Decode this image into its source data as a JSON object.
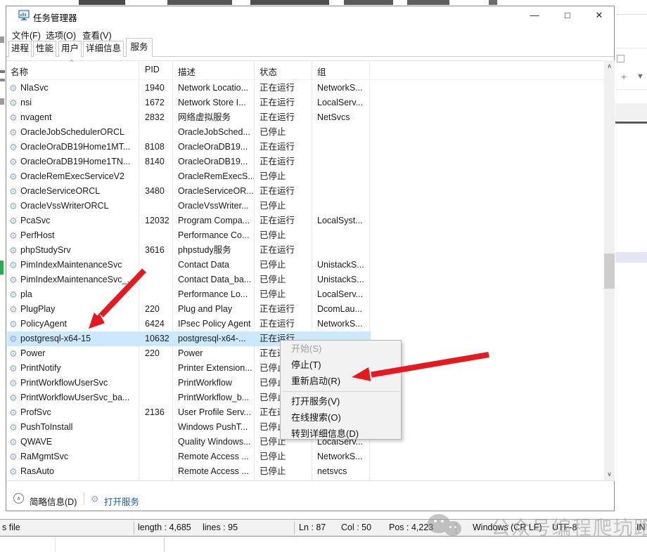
{
  "window": {
    "title": "任务管理器",
    "menu": [
      {
        "label": "文件(F)"
      },
      {
        "label": "选项(O)"
      },
      {
        "label": "查看(V)"
      }
    ],
    "tabs": [
      {
        "label": "进程"
      },
      {
        "label": "性能"
      },
      {
        "label": "用户"
      },
      {
        "label": "详细信息"
      },
      {
        "label": "服务"
      }
    ],
    "caption_buttons": {
      "minimize": "—",
      "maximize": "□",
      "close": "✕"
    }
  },
  "table": {
    "columns": [
      "名称",
      "PID",
      "描述",
      "状态",
      "组"
    ],
    "rows": [
      {
        "name": "NlaSvc",
        "pid": "1940",
        "desc": "Network Locatio...",
        "status": "正在运行",
        "group": "NetworkS..."
      },
      {
        "name": "nsi",
        "pid": "1672",
        "desc": "Network Store I...",
        "status": "正在运行",
        "group": "LocalServ..."
      },
      {
        "name": "nvagent",
        "pid": "2832",
        "desc": "网络虚拟服务",
        "status": "正在运行",
        "group": "NetSvcs"
      },
      {
        "name": "OracleJobSchedulerORCL",
        "pid": "",
        "desc": "OracleJobSched...",
        "status": "已停止",
        "group": ""
      },
      {
        "name": "OracleOraDB19Home1MT...",
        "pid": "8108",
        "desc": "OracleOraDB19...",
        "status": "正在运行",
        "group": ""
      },
      {
        "name": "OracleOraDB19Home1TN...",
        "pid": "8140",
        "desc": "OracleOraDB19...",
        "status": "正在运行",
        "group": ""
      },
      {
        "name": "OracleRemExecServiceV2",
        "pid": "",
        "desc": "OracleRemExecS...",
        "status": "已停止",
        "group": ""
      },
      {
        "name": "OracleServiceORCL",
        "pid": "3480",
        "desc": "OracleServiceOR...",
        "status": "正在运行",
        "group": ""
      },
      {
        "name": "OracleVssWriterORCL",
        "pid": "",
        "desc": "OracleVssWriter...",
        "status": "已停止",
        "group": ""
      },
      {
        "name": "PcaSvc",
        "pid": "12032",
        "desc": "Program Compa...",
        "status": "正在运行",
        "group": "LocalSyst..."
      },
      {
        "name": "PerfHost",
        "pid": "",
        "desc": "Performance Co...",
        "status": "已停止",
        "group": ""
      },
      {
        "name": "phpStudySrv",
        "pid": "3616",
        "desc": "phpstudy服务",
        "status": "正在运行",
        "group": ""
      },
      {
        "name": "PimIndexMaintenanceSvc",
        "pid": "",
        "desc": "Contact Data",
        "status": "已停止",
        "group": "UnistackS..."
      },
      {
        "name": "PimIndexMaintenanceSvc_...",
        "pid": "",
        "desc": "Contact Data_ba...",
        "status": "已停止",
        "group": "UnistackS..."
      },
      {
        "name": "pla",
        "pid": "",
        "desc": "Performance Lo...",
        "status": "已停止",
        "group": "LocalServ..."
      },
      {
        "name": "PlugPlay",
        "pid": "220",
        "desc": "Plug and Play",
        "status": "正在运行",
        "group": "DcomLau..."
      },
      {
        "name": "PolicyAgent",
        "pid": "6424",
        "desc": "IPsec Policy Agent",
        "status": "正在运行",
        "group": "NetworkS..."
      },
      {
        "name": "postgresql-x64-15",
        "pid": "10632",
        "desc": "postgresql-x64-...",
        "status": "正在运行",
        "group": "",
        "selected": true
      },
      {
        "name": "Power",
        "pid": "220",
        "desc": "Power",
        "status": "正在运行",
        "group": ""
      },
      {
        "name": "PrintNotify",
        "pid": "",
        "desc": "Printer Extension...",
        "status": "已停止",
        "group": ""
      },
      {
        "name": "PrintWorkflowUserSvc",
        "pid": "",
        "desc": "PrintWorkflow",
        "status": "已停止",
        "group": ""
      },
      {
        "name": "PrintWorkflowUserSvc_ba...",
        "pid": "",
        "desc": "PrintWorkflow_b...",
        "status": "已停止",
        "group": ""
      },
      {
        "name": "ProfSvc",
        "pid": "2136",
        "desc": "User Profile Serv...",
        "status": "正在运行",
        "group": ""
      },
      {
        "name": "PushToInstall",
        "pid": "",
        "desc": "Windows PushT...",
        "status": "已停止",
        "group": ""
      },
      {
        "name": "QWAVE",
        "pid": "",
        "desc": "Quality Windows...",
        "status": "已停止",
        "group": "LocalServ..."
      },
      {
        "name": "RaMgmtSvc",
        "pid": "",
        "desc": "Remote Access ...",
        "status": "已停止",
        "group": "NetworkS..."
      },
      {
        "name": "RasAuto",
        "pid": "",
        "desc": "Remote Access ...",
        "status": "已停止",
        "group": "netsvcs"
      }
    ]
  },
  "context_menu": {
    "items": [
      {
        "label": "开始(S)",
        "disabled": true
      },
      {
        "label": "停止(T)"
      },
      {
        "label": "重新启动(R)"
      },
      {
        "separator": true
      },
      {
        "label": "打开服务(V)"
      },
      {
        "label": "在线搜索(O)"
      },
      {
        "label": "转到详细信息(D)"
      }
    ]
  },
  "footer": {
    "summary": "简略信息(D)",
    "open_services": "打开服务",
    "chevron": "∧"
  },
  "right_panel": {
    "plus": "+",
    "filter": "▼"
  },
  "scrollbar": {
    "up": "∧",
    "down": "∨"
  },
  "statusbar": {
    "file": "s file",
    "length": "length : 4,685",
    "lines": "lines : 95",
    "line": "Ln : 87",
    "col": "Col : 50",
    "pos": "Pos : 4,223",
    "eol": "Windows (CR LF)",
    "encoding": "UTF-8",
    "mode": "IN"
  },
  "watermark": {
    "prefix": "公众号",
    "suffix": "编程爬坑路"
  },
  "icons": {
    "service": "gear",
    "title": "task-manager-monitor",
    "sort": "^"
  },
  "colors": {
    "selection": "#cce8ff",
    "link": "#0563c1",
    "arrow_red": "#e8181f",
    "menu_bg": "#f2f2f2",
    "disabled_text": "#9e9e9e",
    "gear_icon": "#93aec7",
    "left_green_fragment": "#27ae47",
    "lavender_band": "#e4e5f6"
  }
}
